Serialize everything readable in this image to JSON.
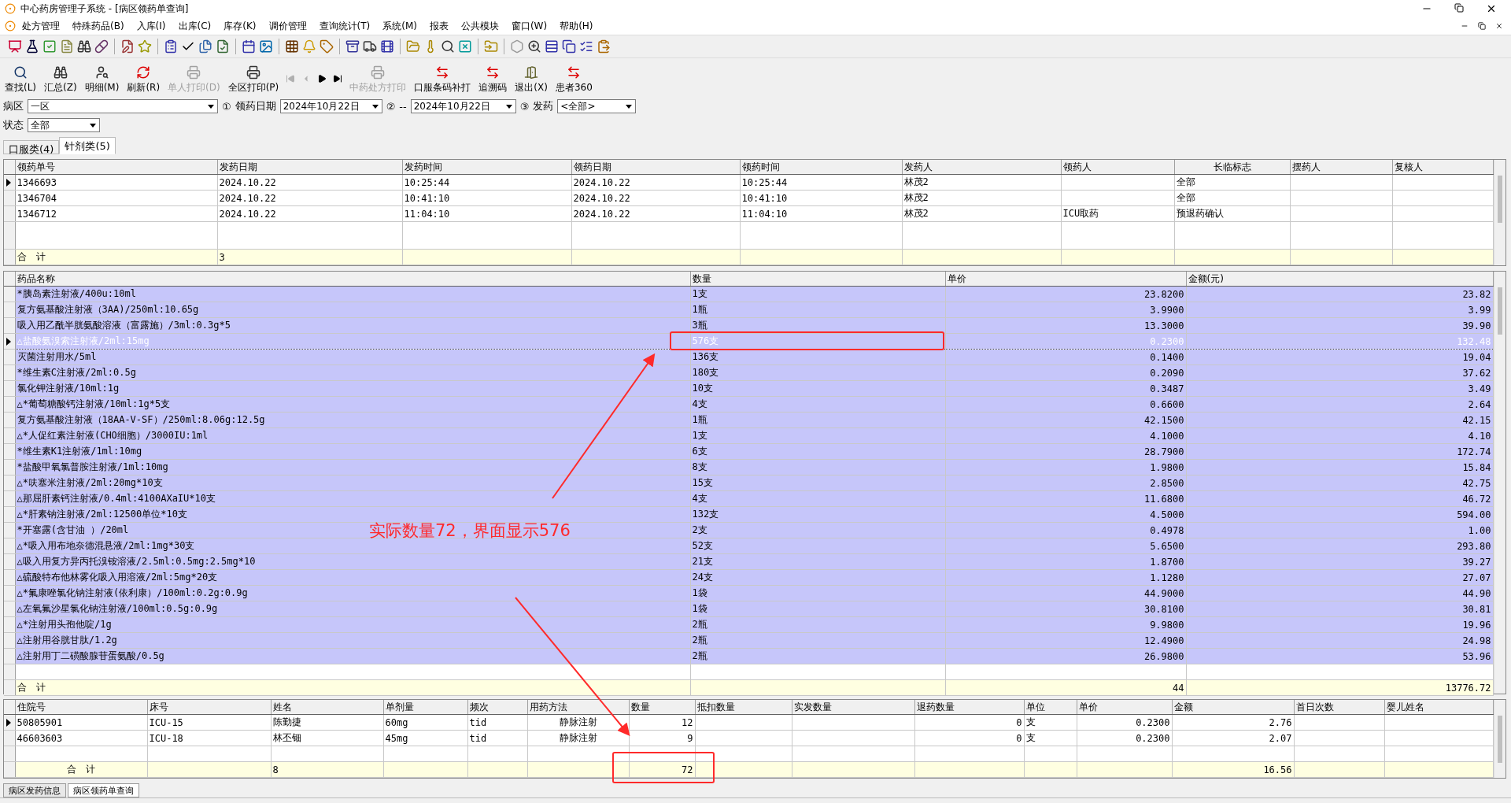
{
  "window": {
    "title": "中心药房管理子系统 - [病区领药单查询]"
  },
  "menu": [
    "处方管理",
    "特殊药品(B)",
    "入库(I)",
    "出库(C)",
    "库存(K)",
    "调价管理",
    "查询统计(T)",
    "系统(M)",
    "报表",
    "公共模块",
    "窗口(W)",
    "帮助(H)"
  ],
  "tool_buttons": [
    {
      "label": "查找(L)",
      "kind": "search",
      "disabled": false
    },
    {
      "label": "汇总(Z)",
      "kind": "binoculars",
      "disabled": false
    },
    {
      "label": "明细(M)",
      "kind": "user",
      "disabled": false
    },
    {
      "label": "刷新(R)",
      "kind": "refresh",
      "disabled": false
    },
    {
      "label": "单人打印(D)",
      "kind": "printer",
      "disabled": true
    },
    {
      "label": "全区打印(P)",
      "kind": "printer",
      "disabled": false
    },
    {
      "kind": "first",
      "disabled": true
    },
    {
      "kind": "prev",
      "disabled": true
    },
    {
      "kind": "next",
      "disabled": false
    },
    {
      "kind": "last",
      "disabled": false
    },
    {
      "label": "中药处方打印",
      "kind": "printer",
      "disabled": true
    },
    {
      "label": "口服条码补打",
      "kind": "arrows",
      "disabled": false
    },
    {
      "label": "追溯码",
      "kind": "arrows",
      "disabled": false
    },
    {
      "label": "退出(X)",
      "kind": "door",
      "disabled": false
    },
    {
      "label": "患者360",
      "kind": "arrows",
      "disabled": false
    }
  ],
  "filters": {
    "ward_label": "病区",
    "ward": "一区",
    "step1": "①",
    "date_label": "领药日期",
    "date_from": "2024年10月22日",
    "step2": "②",
    "dash": "--",
    "date_to": "2024年10月22日",
    "step3": "③",
    "dispense_label": "发药",
    "dispense": "<全部>",
    "status_label": "状态",
    "status": "全部"
  },
  "tabs": [
    {
      "label": "口服类(4)",
      "selected": false
    },
    {
      "label": "针剂类(5)",
      "selected": true
    }
  ],
  "orders_table": {
    "columns": [
      "领药单号",
      "发药日期",
      "发药时间",
      "领药日期",
      "领药时间",
      "发药人",
      "领药人",
      "长临标志",
      "摆药人",
      "复核人"
    ],
    "rows": [
      {
        "selected": true,
        "order_no": "1346693",
        "issue_date": "2024.10.22",
        "issue_time": "10:25:44",
        "receive_date": "2024.10.22",
        "receive_time": "10:25:44",
        "issuer": "林茂2",
        "term_flag": "全部"
      },
      {
        "selected": false,
        "order_no": "1346704",
        "issue_date": "2024.10.22",
        "issue_time": "10:41:10",
        "receive_date": "2024.10.22",
        "receive_time": "10:41:10",
        "issuer": "林茂2",
        "term_flag": "全部"
      },
      {
        "selected": false,
        "order_no": "1346712",
        "issue_date": "2024.10.22",
        "issue_time": "11:04:10",
        "receive_date": "2024.10.22",
        "receive_time": "11:04:10",
        "issuer": "林茂2",
        "receiver": "ICU取药",
        "term_flag": "预退药确认"
      }
    ],
    "totals": {
      "order_no": "合　计",
      "issue_date": "3"
    }
  },
  "drugs_table": {
    "columns": [
      "药品名称",
      "数量",
      "单价",
      "金额(元)"
    ],
    "rows": [
      {
        "selected": false,
        "name": "*胰岛素注射液/400u:10ml",
        "qty": "1支",
        "price": "23.8200",
        "amount": "23.82"
      },
      {
        "selected": false,
        "name": "复方氨基酸注射液（3AA)/250ml:10.65g",
        "qty": "1瓶",
        "price": "3.9900",
        "amount": "3.99"
      },
      {
        "selected": false,
        "name": "吸入用乙酰半胱氨酸溶液（富露施）/3ml:0.3g*5",
        "qty": "3瓶",
        "price": "13.3000",
        "amount": "39.90"
      },
      {
        "selected": true,
        "name": "△盐酸氨溴索注射液/2ml:15mg",
        "qty": "576支",
        "price": "0.2300",
        "amount": "132.48"
      },
      {
        "selected": false,
        "name": "灭菌注射用水/5ml",
        "qty": "136支",
        "price": "0.1400",
        "amount": "19.04"
      },
      {
        "selected": false,
        "name": "*维生素C注射液/2ml:0.5g",
        "qty": "180支",
        "price": "0.2090",
        "amount": "37.62"
      },
      {
        "selected": false,
        "name": "氯化钾注射液/10ml:1g",
        "qty": "10支",
        "price": "0.3487",
        "amount": "3.49"
      },
      {
        "selected": false,
        "name": "△*葡萄糖酸钙注射液/10ml:1g*5支",
        "qty": "4支",
        "price": "0.6600",
        "amount": "2.64"
      },
      {
        "selected": false,
        "name": "复方氨基酸注射液（18AA-V-SF）/250ml:8.06g:12.5g",
        "qty": "1瓶",
        "price": "42.1500",
        "amount": "42.15"
      },
      {
        "selected": false,
        "name": "△*人促红素注射液(CHO细胞）/3000IU:1ml",
        "qty": "1支",
        "price": "4.1000",
        "amount": "4.10"
      },
      {
        "selected": false,
        "name": "*维生素K1注射液/1ml:10mg",
        "qty": "6支",
        "price": "28.7900",
        "amount": "172.74"
      },
      {
        "selected": false,
        "name": "*盐酸甲氧氯普胺注射液/1ml:10mg",
        "qty": "8支",
        "price": "1.9800",
        "amount": "15.84"
      },
      {
        "selected": false,
        "name": "△*呋塞米注射液/2ml:20mg*10支",
        "qty": "15支",
        "price": "2.8500",
        "amount": "42.75"
      },
      {
        "selected": false,
        "name": "△那屈肝素钙注射液/0.4ml:4100AXaIU*10支",
        "qty": "4支",
        "price": "11.6800",
        "amount": "46.72"
      },
      {
        "selected": false,
        "name": "△*肝素钠注射液/2ml:12500单位*10支",
        "qty": "132支",
        "price": "4.5000",
        "amount": "594.00"
      },
      {
        "selected": false,
        "name": "*开塞露(含甘油 ）/20ml",
        "qty": "2支",
        "price": "0.4978",
        "amount": "1.00"
      },
      {
        "selected": false,
        "name": "△*吸入用布地奈德混悬液/2ml:1mg*30支",
        "qty": "52支",
        "price": "5.6500",
        "amount": "293.80"
      },
      {
        "selected": false,
        "name": "△吸入用复方异丙托溴铵溶液/2.5ml:0.5mg:2.5mg*10",
        "qty": "21支",
        "price": "1.8700",
        "amount": "39.27"
      },
      {
        "selected": false,
        "name": "△硫酸特布他林雾化吸入用溶液/2ml:5mg*20支",
        "qty": "24支",
        "price": "1.1280",
        "amount": "27.07"
      },
      {
        "selected": false,
        "name": "△*氟康唑氯化钠注射液(依利康）/100ml:0.2g:0.9g",
        "qty": "1袋",
        "price": "44.9000",
        "amount": "44.90"
      },
      {
        "selected": false,
        "name": "△左氧氟沙星氯化钠注射液/100ml:0.5g:0.9g",
        "qty": "1袋",
        "price": "30.8100",
        "amount": "30.81"
      },
      {
        "selected": false,
        "name": "△*注射用头孢他啶/1g",
        "qty": "2瓶",
        "price": "9.9800",
        "amount": "19.96"
      },
      {
        "selected": false,
        "name": "△注射用谷胱甘肽/1.2g",
        "qty": "2瓶",
        "price": "12.4900",
        "amount": "24.98"
      },
      {
        "selected": false,
        "name": "△注射用丁二磺酸腺苷蛋氨酸/0.5g",
        "qty": "2瓶",
        "price": "26.9800",
        "amount": "53.96"
      }
    ],
    "totals": {
      "name": "合　计",
      "price": "44",
      "amount": "13776.72"
    }
  },
  "patients_table": {
    "columns": [
      "住院号",
      "床号",
      "姓名",
      "单剂量",
      "频次",
      "用药方法",
      "数量",
      "抵扣数量",
      "实发数量",
      "退药数量",
      "单位",
      "单价",
      "金额",
      "首日次数",
      "婴儿姓名"
    ],
    "rows": [
      {
        "selected": true,
        "admission_no": "50805901",
        "bed": "ICU-15",
        "patient": "陈勤捷",
        "dose": "60mg",
        "frequency": "tid",
        "route": "静脉注射",
        "qty": "12",
        "return_qty": "0",
        "unit": "支",
        "price": "0.2300",
        "amount": "2.76"
      },
      {
        "selected": false,
        "admission_no": "46603603",
        "bed": "ICU-18",
        "patient": "林丕钿",
        "dose": "45mg",
        "frequency": "tid",
        "route": "静脉注射",
        "qty": "9",
        "return_qty": "0",
        "unit": "支",
        "price": "0.2300",
        "amount": "2.07"
      }
    ],
    "totals": {
      "admission_no": "合　计",
      "patient": "8",
      "qty": "72",
      "amount": "16.56"
    }
  },
  "bottom_tabs": [
    {
      "label": "病区发药信息",
      "selected": false
    },
    {
      "label": "病区领药单查询",
      "selected": true
    }
  ],
  "annotation": {
    "text": "实际数量72，界面显示576"
  }
}
